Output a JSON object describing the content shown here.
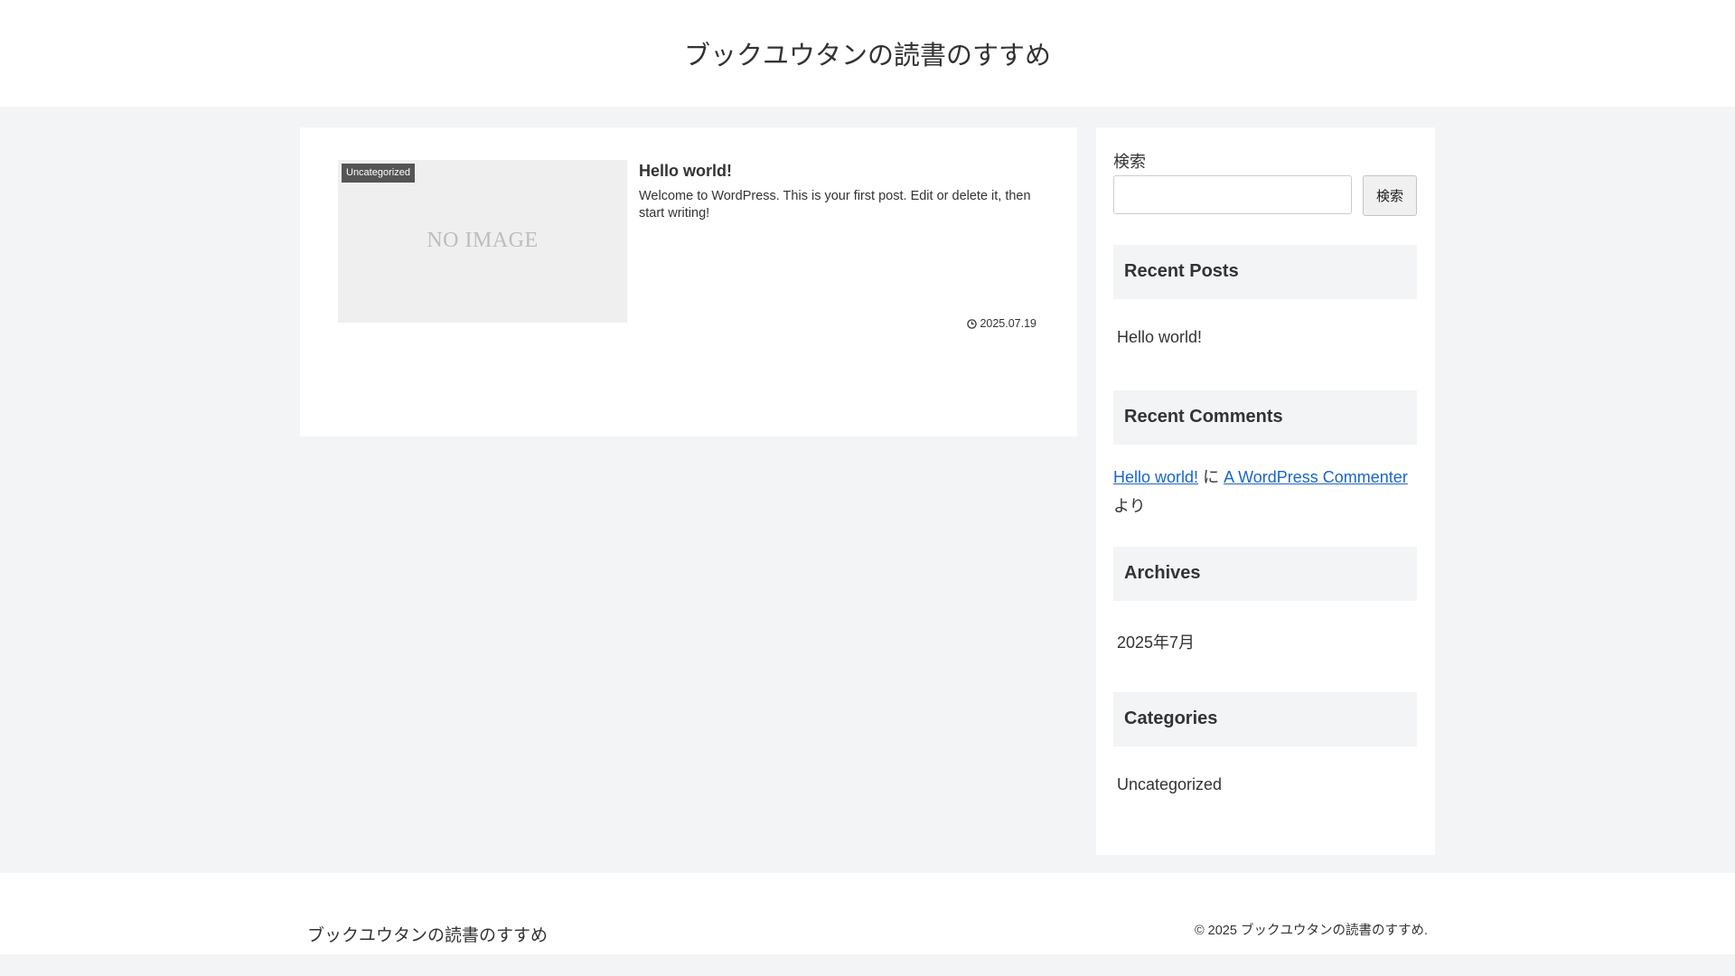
{
  "header": {
    "site_title": "ブックユウタンの読書のすすめ"
  },
  "main": {
    "entries": [
      {
        "thumbnail_text": "NO IMAGE",
        "category": "Uncategorized",
        "title": "Hello world!",
        "snippet": "Welcome to WordPress. This is your first post. Edit or delete it, then start writing!",
        "date": "2025.07.19",
        "date_icon": "clock-icon"
      }
    ]
  },
  "sidebar": {
    "search": {
      "label": "検索",
      "input_value": "",
      "button_label": "検索"
    },
    "recent_posts": {
      "heading": "Recent Posts",
      "items": [
        "Hello world!"
      ]
    },
    "recent_comments": {
      "heading": "Recent Comments",
      "post_link": "Hello world!",
      "connector": "に",
      "author_link": "A WordPress Commenter",
      "suffix": "より"
    },
    "archives": {
      "heading": "Archives",
      "items": [
        "2025年7月"
      ]
    },
    "categories": {
      "heading": "Categories",
      "items": [
        "Uncategorized"
      ]
    }
  },
  "footer": {
    "site_title": "ブックユウタンの読書のすすめ",
    "copyright": "© 2025 ブックユウタンの読書のすすめ."
  },
  "colors": {
    "page_background": "#f3f4f6",
    "card_background": "#ffffff",
    "link": "#1a66c8",
    "badge": "#555555",
    "thumbnail": "#efefef"
  }
}
